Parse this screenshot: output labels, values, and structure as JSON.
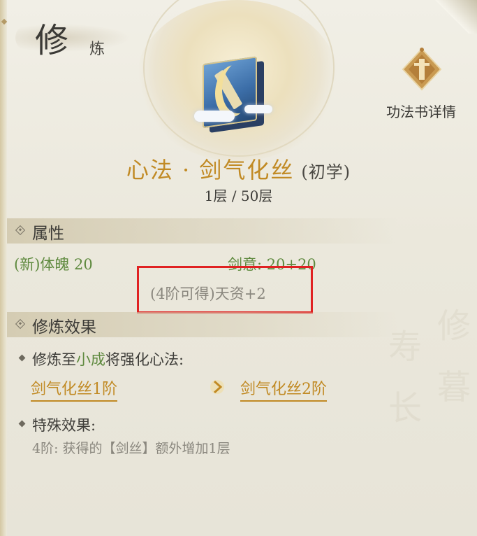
{
  "header": {
    "title_main": "修",
    "title_sub": "炼"
  },
  "detail_button": {
    "label": "功法书详情"
  },
  "skill": {
    "name": "心法 · 剑气化丝",
    "grade": "(初学)",
    "level": "1层 / 50层"
  },
  "attributes": {
    "section_title": "属性",
    "stat_1": "(新)体魄 20",
    "stat_2": "剑意: 20+20",
    "unlock_hint": "(4阶可得)天资+2"
  },
  "cultivation": {
    "section_title": "修炼效果",
    "intro_prefix": "修炼至",
    "intro_stage": "小成",
    "intro_suffix": "将强化心法:",
    "from_skill": "剑气化丝1阶",
    "to_skill": "剑气化丝2阶",
    "special_title": "特殊效果:",
    "special_desc": "4阶: 获得的【剑丝】额外增加1层"
  },
  "colors": {
    "accent_gold": "#c18a24",
    "stat_green": "#5f8a3f",
    "highlight_red": "#e02222"
  },
  "icons": {
    "emblem": "skill-book-icon",
    "detail": "scroll-badge-icon",
    "arrow": "chevron-right-icon"
  }
}
